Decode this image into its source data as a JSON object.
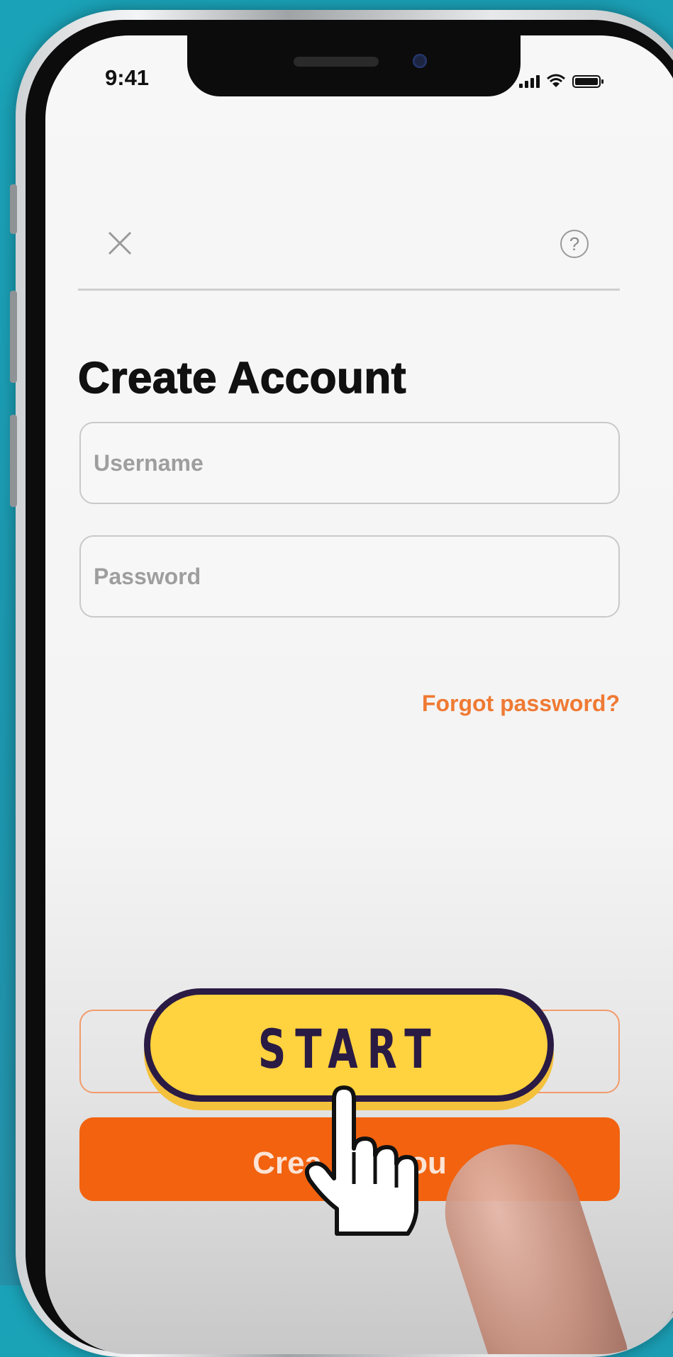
{
  "status_bar": {
    "time": "9:41"
  },
  "header": {
    "close_icon": "close-icon",
    "help_label": "?"
  },
  "page": {
    "title": "Create Account"
  },
  "form": {
    "username_placeholder": "Username",
    "password_placeholder": "Password",
    "forgot_password": "Forgot password?"
  },
  "actions": {
    "primary_visible_label": "Crea        cou"
  },
  "overlay": {
    "start_label": "START",
    "hand_icon": "pointing-hand-icon"
  },
  "colors": {
    "background": "#1d9fb5",
    "accent_orange": "#f2620f",
    "link_orange": "#ef7a34",
    "start_yellow": "#ffd23f",
    "start_outline": "#2a1b44"
  }
}
